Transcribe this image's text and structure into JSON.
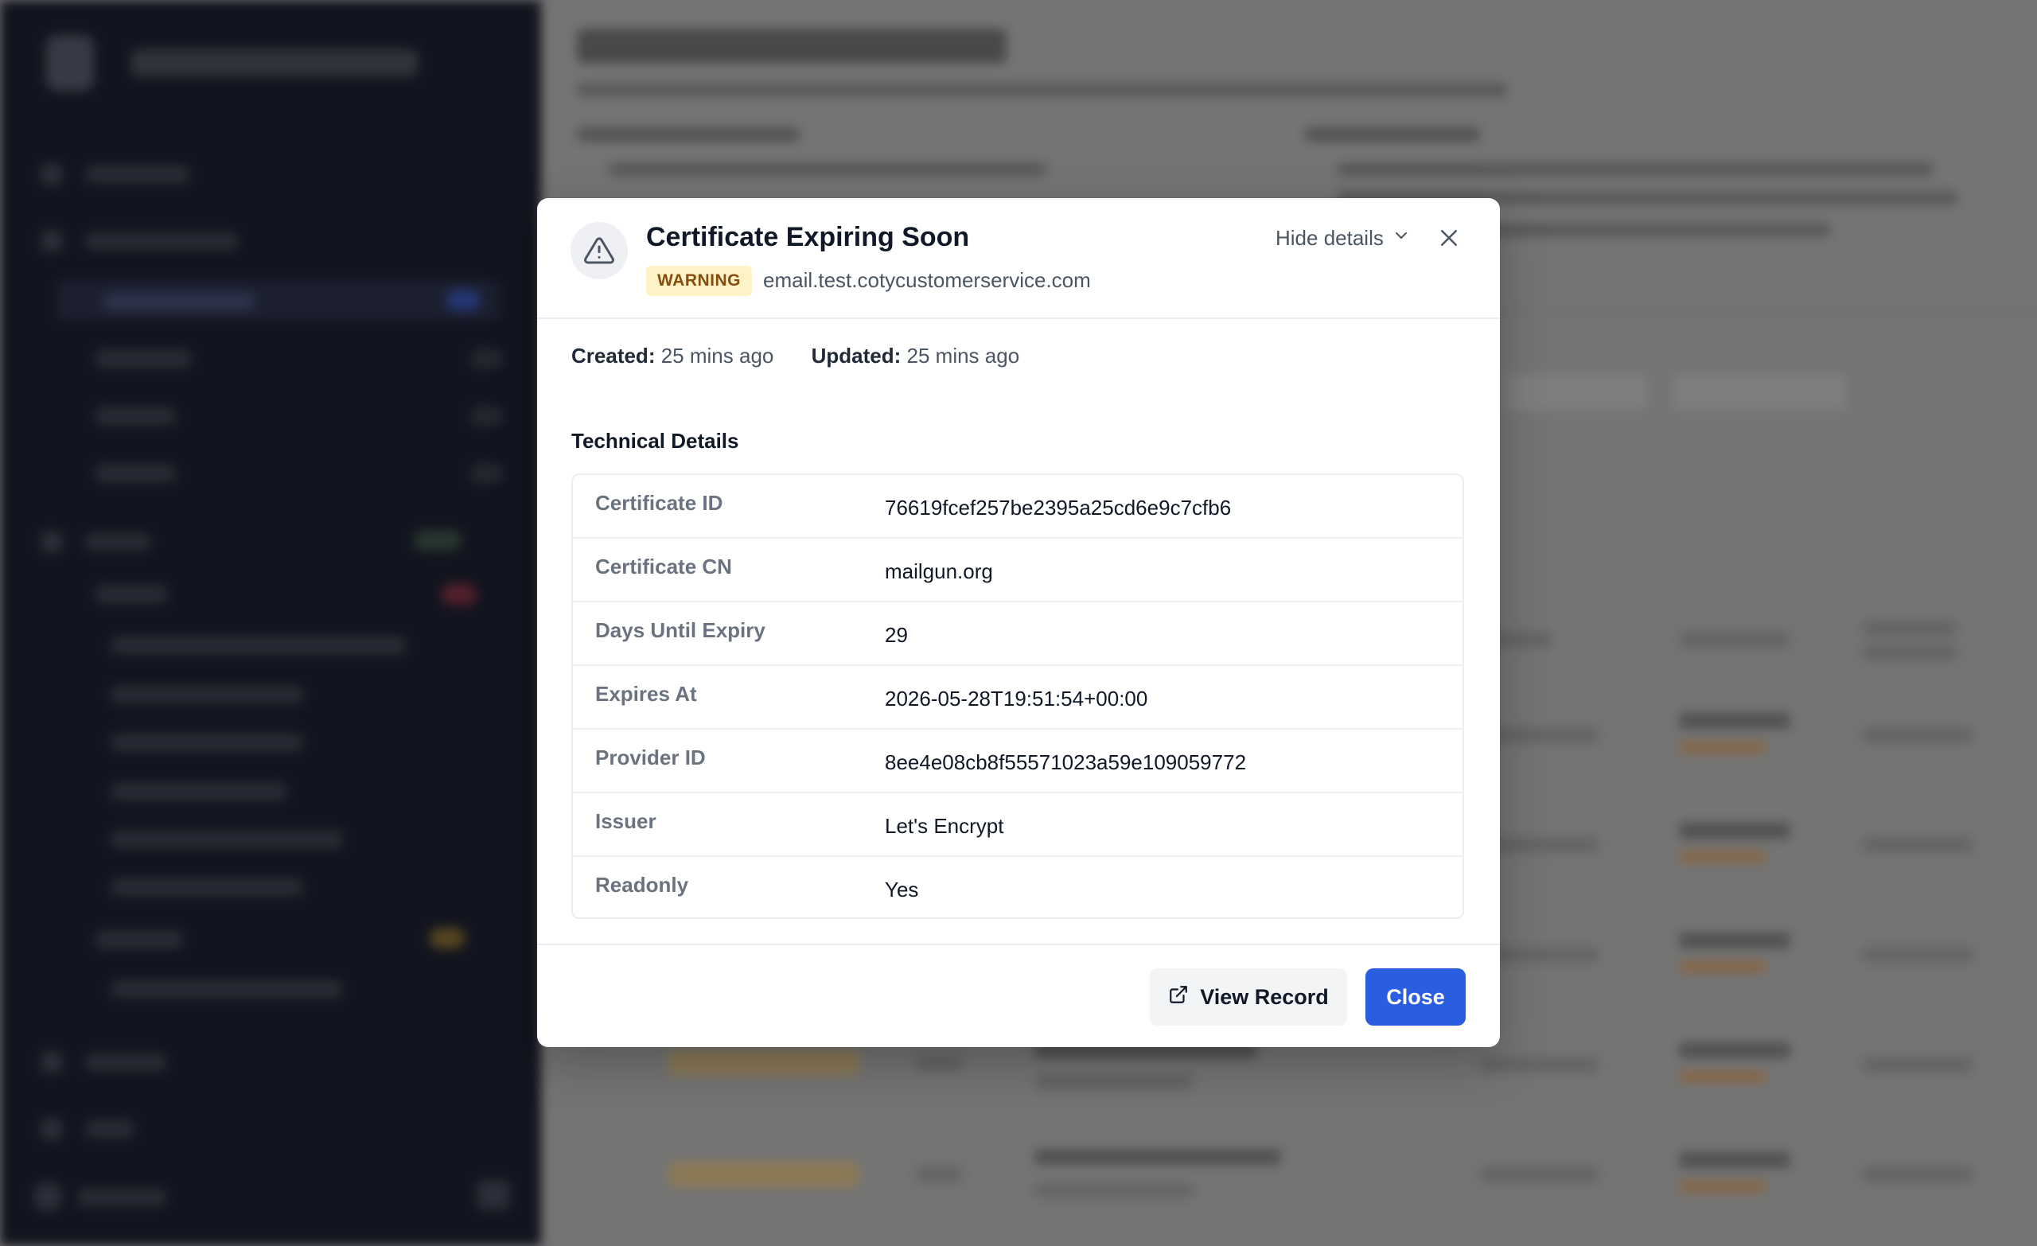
{
  "modal": {
    "title": "Certificate Expiring Soon",
    "severity": "WARNING",
    "domain": "email.test.cotycustomerservice.com",
    "hide_details_label": "Hide details",
    "created_label": "Created:",
    "created_value": "25 mins ago",
    "updated_label": "Updated:",
    "updated_value": "25 mins ago",
    "section_title": "Technical Details",
    "details": [
      {
        "key": "Certificate ID",
        "value": "76619fcef257be2395a25cd6e9c7cfb6"
      },
      {
        "key": "Certificate CN",
        "value": "mailgun.org"
      },
      {
        "key": "Days Until Expiry",
        "value": "29"
      },
      {
        "key": "Expires At",
        "value": "2026-05-28T19:51:54+00:00"
      },
      {
        "key": "Provider ID",
        "value": "8ee4e08cb8f55571023a59e109059772"
      },
      {
        "key": "Issuer",
        "value": "Let's Encrypt"
      },
      {
        "key": "Readonly",
        "value": "Yes"
      }
    ],
    "view_record_label": "View Record",
    "close_label": "Close"
  },
  "icons": {
    "severity": "warning-triangle-icon",
    "expand": "chevron-down-icon",
    "dismiss": "close-icon",
    "external": "external-link-icon"
  },
  "colors": {
    "primary_button": "#2b5de0",
    "warning_badge_bg": "#fef3c7",
    "warning_badge_text": "#854d0e"
  }
}
